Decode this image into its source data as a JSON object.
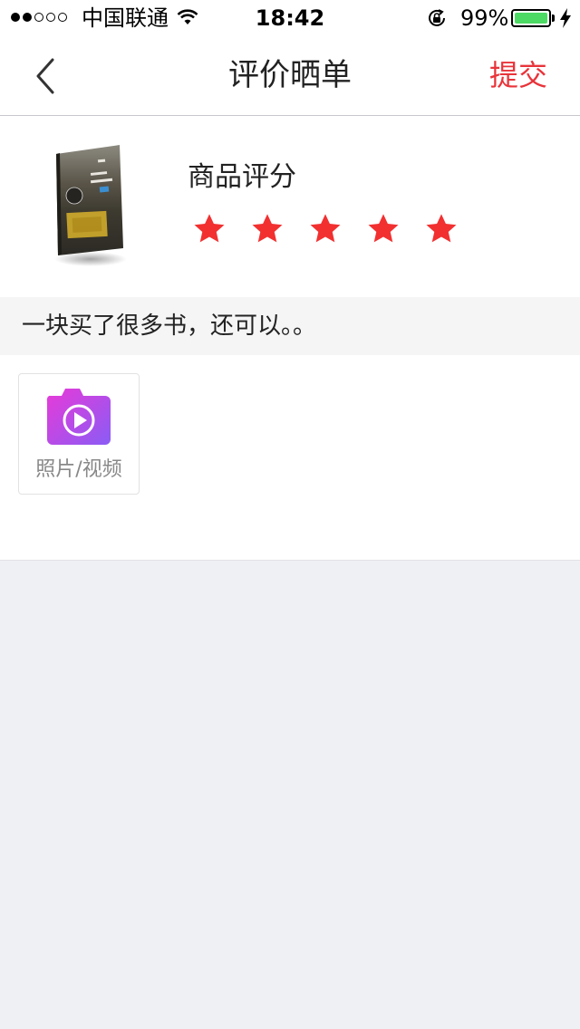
{
  "status_bar": {
    "carrier": "中国联通",
    "time": "18:42",
    "battery_percent": "99%",
    "battery_level": 0.99,
    "signal_strength": 2,
    "signal_max": 5
  },
  "nav": {
    "title": "评价晒单",
    "submit_label": "提交",
    "back_icon": "chevron-left-icon"
  },
  "product": {
    "rating_label": "商品评分",
    "rating": 5,
    "rating_max": 5,
    "star_color": "#f23030"
  },
  "review": {
    "text": "一块买了很多书，还可以。。"
  },
  "upload": {
    "label": "照片/视频",
    "icon": "camera-video-icon"
  },
  "colors": {
    "accent": "#e8343a",
    "battery": "#4cd964",
    "background": "#eff0f4"
  }
}
